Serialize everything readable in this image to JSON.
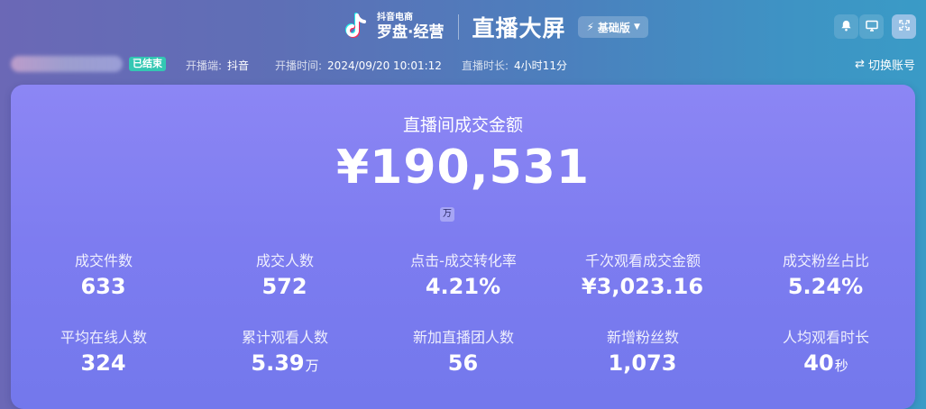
{
  "header": {
    "logo_small": "抖音电商",
    "logo_main": "罗盘·经营",
    "title": "直播大屏",
    "version_label": "基础版",
    "icons": [
      "bell-icon",
      "monitor-icon",
      "fullscreen-icon"
    ]
  },
  "info": {
    "status_badge": "已结束",
    "platform_label": "开播端:",
    "platform_value": "抖音",
    "start_label": "开播时间:",
    "start_value": "2024/09/20 10:01:12",
    "duration_label": "直播时长:",
    "duration_value": "4小时11分",
    "switch_account": "切换账号"
  },
  "main": {
    "label": "直播间成交金额",
    "value": "¥190,531",
    "unit_chip": "万"
  },
  "metrics_row1": [
    {
      "label": "成交件数",
      "value": "633",
      "unit": ""
    },
    {
      "label": "成交人数",
      "value": "572",
      "unit": ""
    },
    {
      "label": "点击-成交转化率",
      "value": "4.21%",
      "unit": ""
    },
    {
      "label": "千次观看成交金额",
      "value": "¥3,023.16",
      "unit": ""
    },
    {
      "label": "成交粉丝占比",
      "value": "5.24%",
      "unit": ""
    }
  ],
  "metrics_row2": [
    {
      "label": "平均在线人数",
      "value": "324",
      "unit": ""
    },
    {
      "label": "累计观看人数",
      "value": "5.39",
      "unit": "万"
    },
    {
      "label": "新加直播团人数",
      "value": "56",
      "unit": ""
    },
    {
      "label": "新增粉丝数",
      "value": "1,073",
      "unit": ""
    },
    {
      "label": "人均观看时长",
      "value": "40",
      "unit": "秒"
    }
  ],
  "colors": {
    "badge": "#33c7b3",
    "card_top": "#8c86f4",
    "card_bottom": "#7378ec"
  }
}
